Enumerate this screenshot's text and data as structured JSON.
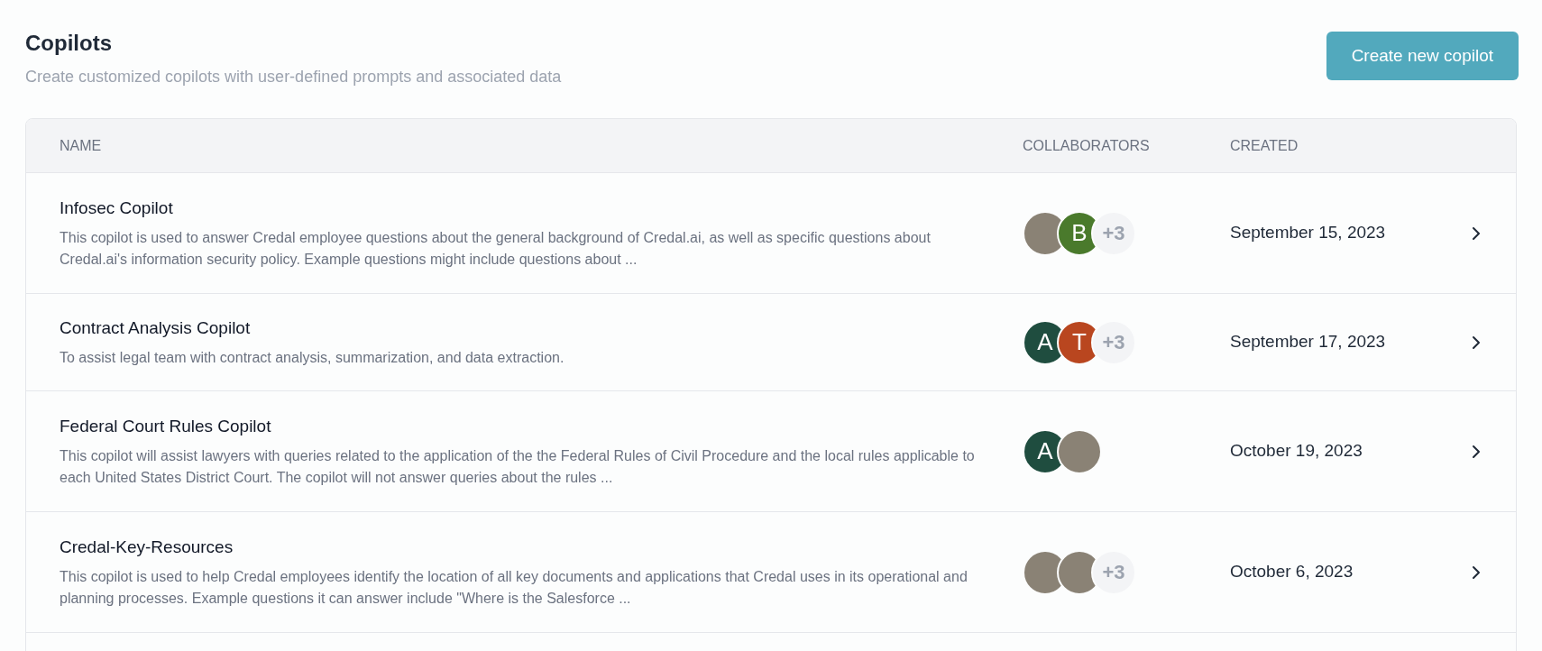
{
  "page": {
    "title": "Copilots",
    "subtitle": "Create customized copilots with user-defined prompts and associated data",
    "create_button": "Create new copilot"
  },
  "table": {
    "columns": [
      "NAME",
      "COLLABORATORS",
      "CREATED"
    ],
    "rows": [
      {
        "name": "Infosec Copilot",
        "description": "This copilot is used to answer Credal employee questions about the general background of Credal.ai, as well as specific questions about Credal.ai's information security policy. Example questions might include questions about ...",
        "collaborators": [
          {
            "kind": "photo"
          },
          {
            "kind": "initial",
            "text": "B",
            "color": "#4a7a2c"
          },
          {
            "kind": "count",
            "text": "+3"
          }
        ],
        "created": "September 15, 2023"
      },
      {
        "name": "Contract Analysis Copilot",
        "description": "To assist legal team with contract analysis, summarization, and data extraction.",
        "collaborators": [
          {
            "kind": "initial",
            "text": "A",
            "color": "#1f4d3f"
          },
          {
            "kind": "initial",
            "text": "T",
            "color": "#b9461f"
          },
          {
            "kind": "count",
            "text": "+3"
          }
        ],
        "created": "September 17, 2023"
      },
      {
        "name": "Federal Court Rules Copilot",
        "description": "This copilot will assist lawyers with queries related to the application of the the Federal Rules of Civil Procedure and the local rules applicable to each United States District Court. The copilot will not answer queries about the rules ...",
        "collaborators": [
          {
            "kind": "initial",
            "text": "A",
            "color": "#1f4d3f"
          },
          {
            "kind": "photo"
          }
        ],
        "created": "October 19, 2023"
      },
      {
        "name": "Credal-Key-Resources",
        "description": "This copilot is used to help Credal employees identify the location of all key documents and applications that Credal uses in its operational and planning processes. Example questions it can answer include \"Where is the Salesforce ...",
        "collaborators": [
          {
            "kind": "photo"
          },
          {
            "kind": "photo"
          },
          {
            "kind": "count",
            "text": "+3"
          }
        ],
        "created": "October 6, 2023"
      }
    ]
  }
}
